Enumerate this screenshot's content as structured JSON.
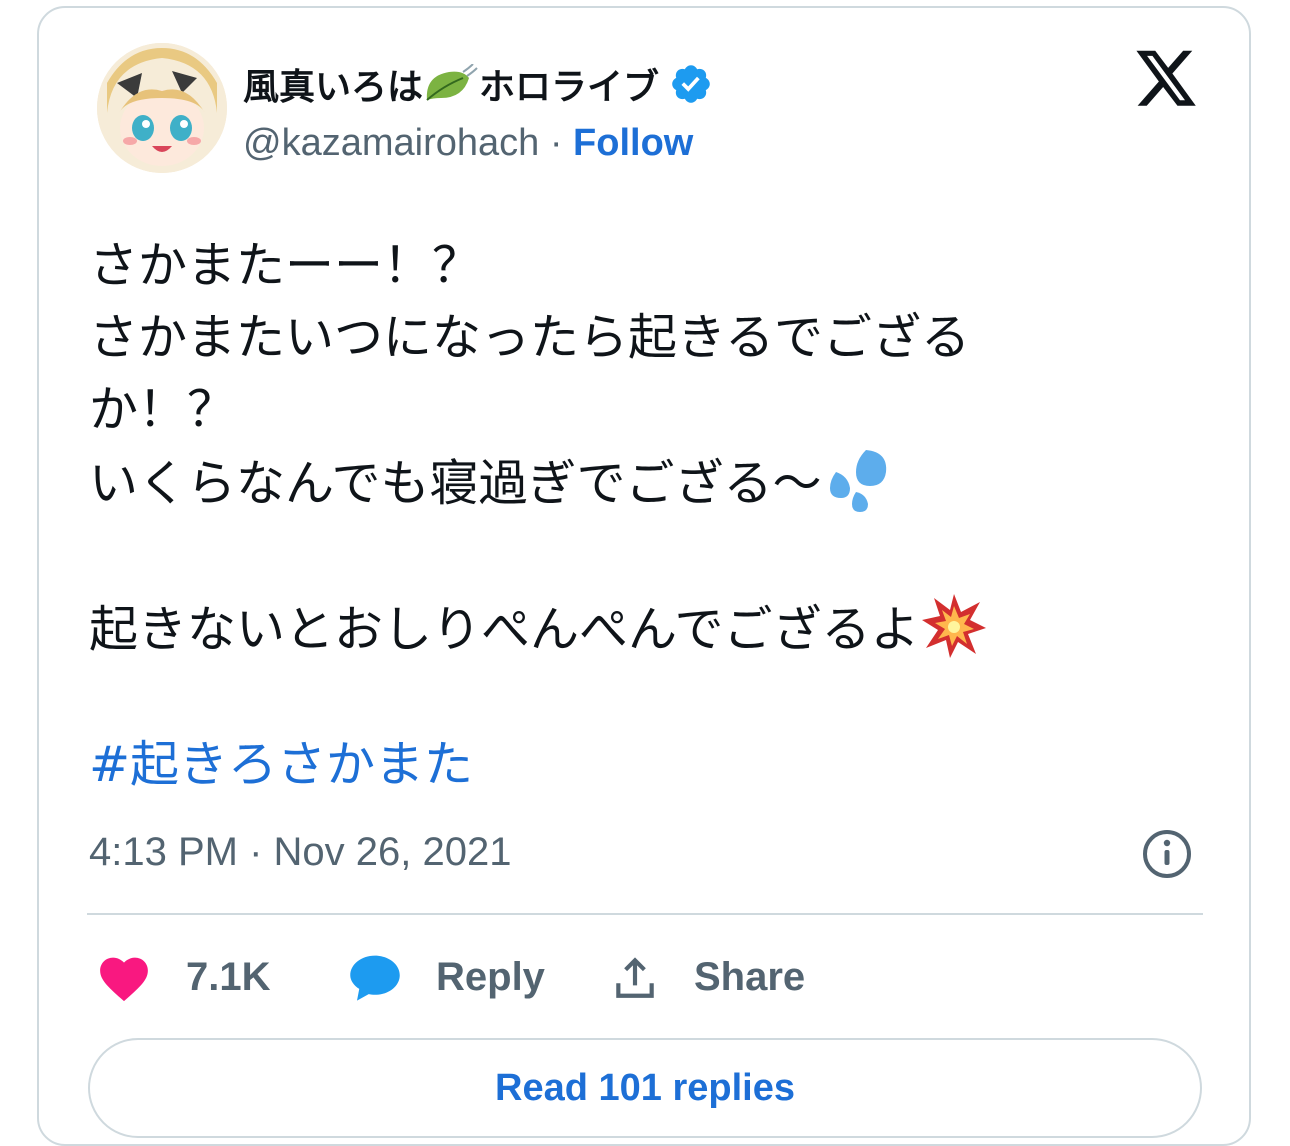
{
  "author": {
    "display_name": "風真いろは",
    "display_suffix": "ホロライブ",
    "handle": "@kazamairohach",
    "separator": " · ",
    "follow_label": "Follow"
  },
  "tweet": {
    "lines": [
      "さかまたーー！？",
      "さかまたいつになったら起きるでござる",
      "か！？",
      "いくらなんでも寝過ぎでござる〜",
      "",
      "起きないとおしりぺんぺんでござるよ"
    ],
    "hashtag": "#起きろさかまた",
    "timestamp": "4:13 PM · Nov 26, 2021"
  },
  "actions": {
    "likes": "7.1K",
    "reply_label": "Reply",
    "share_label": "Share"
  },
  "read_replies_label": "Read 101 replies",
  "colors": {
    "link_blue": "#1d6fd6",
    "verified_blue": "#1d9bf0",
    "heart_pink": "#f91880",
    "muted_gray": "#536471",
    "border": "#cfd9de"
  },
  "icons": [
    "leaf-icon",
    "verified-icon",
    "x-logo-icon",
    "sweat-drops-icon",
    "collision-icon",
    "info-icon",
    "heart-icon",
    "reply-bubble-icon",
    "share-icon"
  ]
}
